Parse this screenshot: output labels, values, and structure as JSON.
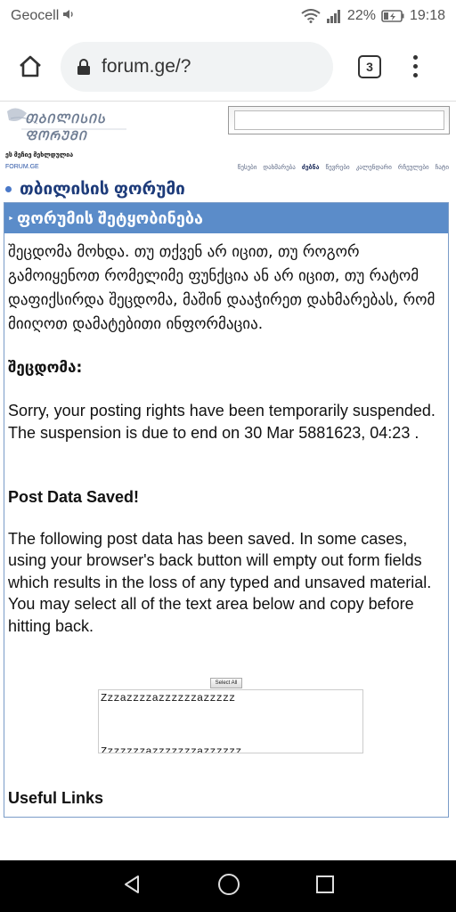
{
  "status": {
    "carrier": "Geocell",
    "battery": "22%",
    "time": "19:18"
  },
  "browser": {
    "url": "forum.ge/?",
    "tab_count": "3"
  },
  "header": {
    "logo_text": "ᲗᲑᲘᲚᲘᲡᲘᲡ ᲤᲝᲠᲣᲛᲘ",
    "greeting": "ეს მეჩიე მეხლდულია",
    "site_label": "FORUM.GE",
    "nav_links": [
      "წესები",
      "დახმარება",
      "ძებნა",
      "წევრები",
      "კალენდარი",
      "რჩეულები",
      "ჩატი"
    ]
  },
  "forum_title": "თბილისის ფორუმი",
  "message_box": {
    "header": "ფორუმის შეტყობინება",
    "intro": "შეცდომა მოხდა. თუ თქვენ არ იცით, თუ როგორ გამოიყენოთ რომელიმე ფუნქცია ან არ იცით, თუ რატომ დაფიქსირდა შეცდომა, მაშინ დააჭირეთ დახმარებას, რომ მიიღოთ დამატებითი ინფორმაცია.",
    "error_label": "შეცდომა:",
    "error_text": " Sorry, your posting rights have been temporarily suspended. The suspension is due to end on 30 Mar 5881623, 04:23 .",
    "saved_title": "Post Data Saved!",
    "saved_text": "The following post data has been saved. In some cases, using your browser's back button will empty out form fields which results in the loss of any typed and unsaved material. You may select all of the text area below and copy before hitting back.",
    "select_all_label": "Select All",
    "saved_data": "Zzzazzzzazzzzzzazzzzz\n\n\n\nZzzzzzzazzzzzzzazzzzzz",
    "useful_links": "Useful Links"
  }
}
